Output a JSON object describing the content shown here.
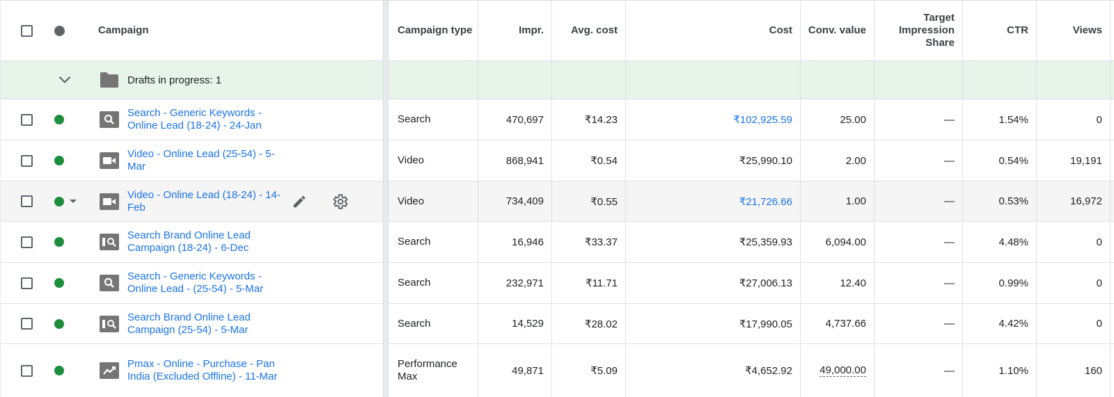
{
  "headers": {
    "campaign": "Campaign",
    "campaign_type": "Campaign type",
    "impr": "Impr.",
    "avg_cost": "Avg. cost",
    "cost": "Cost",
    "conv_value": "Conv. value",
    "target_impression_share": "Target Impression Share",
    "ctr": "CTR",
    "views": "Views"
  },
  "drafts": {
    "label": "Drafts in progress: 1"
  },
  "colors": {
    "accent": "#1a73e8",
    "status_enabled": "#1e8e3e",
    "draft_bg": "#e6f4ea"
  },
  "rows": [
    {
      "icon": "search-campaign-icon",
      "name": "Search - Generic Keywords - Online Lead (18-24) - 24-Jan",
      "type": "Search",
      "impr": "470,697",
      "avg_cost": "₹14.23",
      "cost": "₹102,925.59",
      "conv_value": "25.00",
      "tis": "—",
      "ctr": "1.54%",
      "views": "0"
    },
    {
      "icon": "video-campaign-icon",
      "name": "Video - Online Lead (25-54) - 5-Mar",
      "type": "Video",
      "impr": "868,941",
      "avg_cost": "₹0.54",
      "cost": "₹25,990.10",
      "conv_value": "2.00",
      "tis": "—",
      "ctr": "0.54%",
      "views": "19,191"
    },
    {
      "icon": "video-campaign-icon",
      "name": "Video - Online Lead (18-24) - 14-Feb",
      "type": "Video",
      "impr": "734,409",
      "avg_cost": "₹0.55",
      "cost": "₹21,726.66",
      "conv_value": "1.00",
      "tis": "—",
      "ctr": "0.53%",
      "views": "16,972"
    },
    {
      "icon": "search-brand-campaign-icon",
      "name": "Search Brand Online Lead Campaign (18-24) - 6-Dec",
      "type": "Search",
      "impr": "16,946",
      "avg_cost": "₹33.37",
      "cost": "₹25,359.93",
      "conv_value": "6,094.00",
      "tis": "—",
      "ctr": "4.48%",
      "views": "0"
    },
    {
      "icon": "search-campaign-icon",
      "name": "Search - Generic Keywords - Online Lead - (25-54) - 5-Mar",
      "type": "Search",
      "impr": "232,971",
      "avg_cost": "₹11.71",
      "cost": "₹27,006.13",
      "conv_value": "12.40",
      "tis": "—",
      "ctr": "0.99%",
      "views": "0"
    },
    {
      "icon": "search-brand-campaign-icon",
      "name": "Search Brand Online Lead Campaign (25-54) - 5-Mar",
      "type": "Search",
      "impr": "14,529",
      "avg_cost": "₹28.02",
      "cost": "₹17,990.05",
      "conv_value": "4,737.66",
      "tis": "—",
      "ctr": "4.42%",
      "views": "0"
    },
    {
      "icon": "pmax-campaign-icon",
      "name": "Pmax - Online - Purchase - Pan India (Excluded Offline) - 11-Mar",
      "type": "Performance Max",
      "impr": "49,871",
      "avg_cost": "₹5.09",
      "cost": "₹4,652.92",
      "conv_value": "49,000.00",
      "tis": "—",
      "ctr": "1.10%",
      "views": "160"
    }
  ]
}
